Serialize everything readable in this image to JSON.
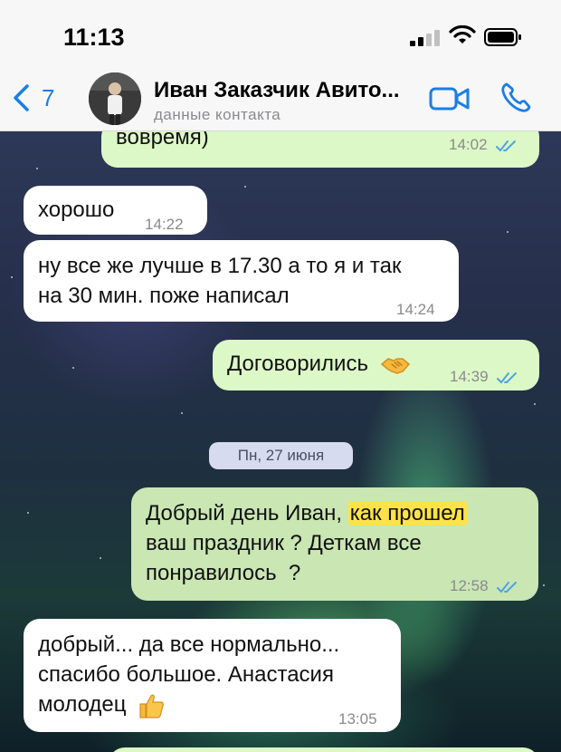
{
  "status_bar": {
    "time": "11:13"
  },
  "header": {
    "back_count": "7",
    "contact_name": "Иван Заказчик Авито...",
    "contact_subtitle": "данные контакта"
  },
  "date_separator": "Пн, 27 июня",
  "messages": [
    {
      "direction": "out",
      "lines": [
        "вовремя)"
      ],
      "time": "14:02",
      "read": true
    },
    {
      "direction": "in",
      "lines": [
        "хорошо"
      ],
      "time": "14:22"
    },
    {
      "direction": "in",
      "lines": [
        "ну все же лучше в 17.30 а то я и так",
        "на 30 мин. поже написал"
      ],
      "time": "14:24"
    },
    {
      "direction": "out",
      "lines": [
        "Договорились"
      ],
      "emoji": "handshake",
      "time": "14:39",
      "read": true
    },
    {
      "direction": "out",
      "lines_parts": [
        [
          "Добрый день Иван, ",
          "как прошел"
        ],
        [
          "ваш праздник ? Деткам все"
        ],
        [
          "понравилось  ?"
        ]
      ],
      "highlight": "как прошел",
      "time": "12:58",
      "read": true
    },
    {
      "direction": "in",
      "lines": [
        "добрый... да все нормально...",
        "спасибо большое. Анастасия",
        "молодец"
      ],
      "emoji": "thumbs-up",
      "time": "13:05"
    }
  ],
  "colors": {
    "accent": "#1a7ee6",
    "outgoing_bubble": "#dcf8c6",
    "incoming_bubble": "#ffffff",
    "highlight": "#ffe24a",
    "read_ticks": "#4fa3e0"
  }
}
